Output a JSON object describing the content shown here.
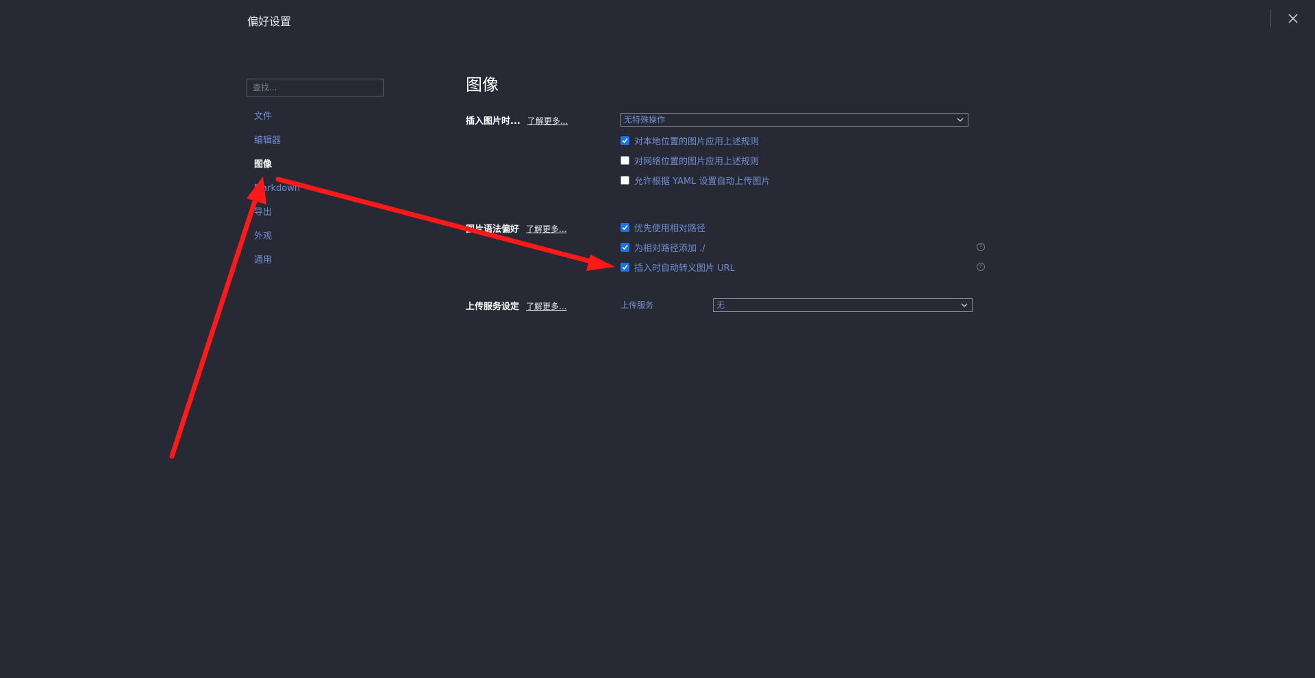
{
  "window": {
    "title": "偏好设置"
  },
  "sidebar": {
    "search_placeholder": "查找...",
    "items": [
      {
        "label": "文件"
      },
      {
        "label": "编辑器"
      },
      {
        "label": "图像"
      },
      {
        "label": "Markdown"
      },
      {
        "label": "导出"
      },
      {
        "label": "外观"
      },
      {
        "label": "通用"
      }
    ],
    "active_item": "图像"
  },
  "main": {
    "page_title": "图像",
    "insert_section": {
      "label": "插入图片时...",
      "learn_more": "了解更多...",
      "select_value": "无特殊操作",
      "options": [
        {
          "label": "对本地位置的图片应用上述规则",
          "checked": true
        },
        {
          "label": "对网络位置的图片应用上述规则",
          "checked": false
        },
        {
          "label": "允许根据 YAML 设置自动上传图片",
          "checked": false
        }
      ]
    },
    "syntax_section": {
      "label": "图片语法偏好",
      "learn_more": "了解更多...",
      "options": [
        {
          "label": "优先使用相对路径",
          "checked": true
        },
        {
          "label": "为相对路径添加 ./",
          "checked": true,
          "help": "?"
        },
        {
          "label": "插入时自动转义图片 URL",
          "checked": true,
          "help": "?"
        }
      ]
    },
    "upload_section": {
      "label": "上传服务设定",
      "learn_more": "了解更多...",
      "service_label": "上传服务",
      "select_value": "无"
    }
  },
  "icons": {
    "close": "close-icon",
    "chevron": "chevron-down-icon",
    "check": "check-icon",
    "help": "help-icon"
  },
  "colors": {
    "background": "#272935",
    "link_blue": "#6f8fd0",
    "checkbox_blue": "#1a73e8",
    "annotation_red": "#ff1a1a"
  }
}
